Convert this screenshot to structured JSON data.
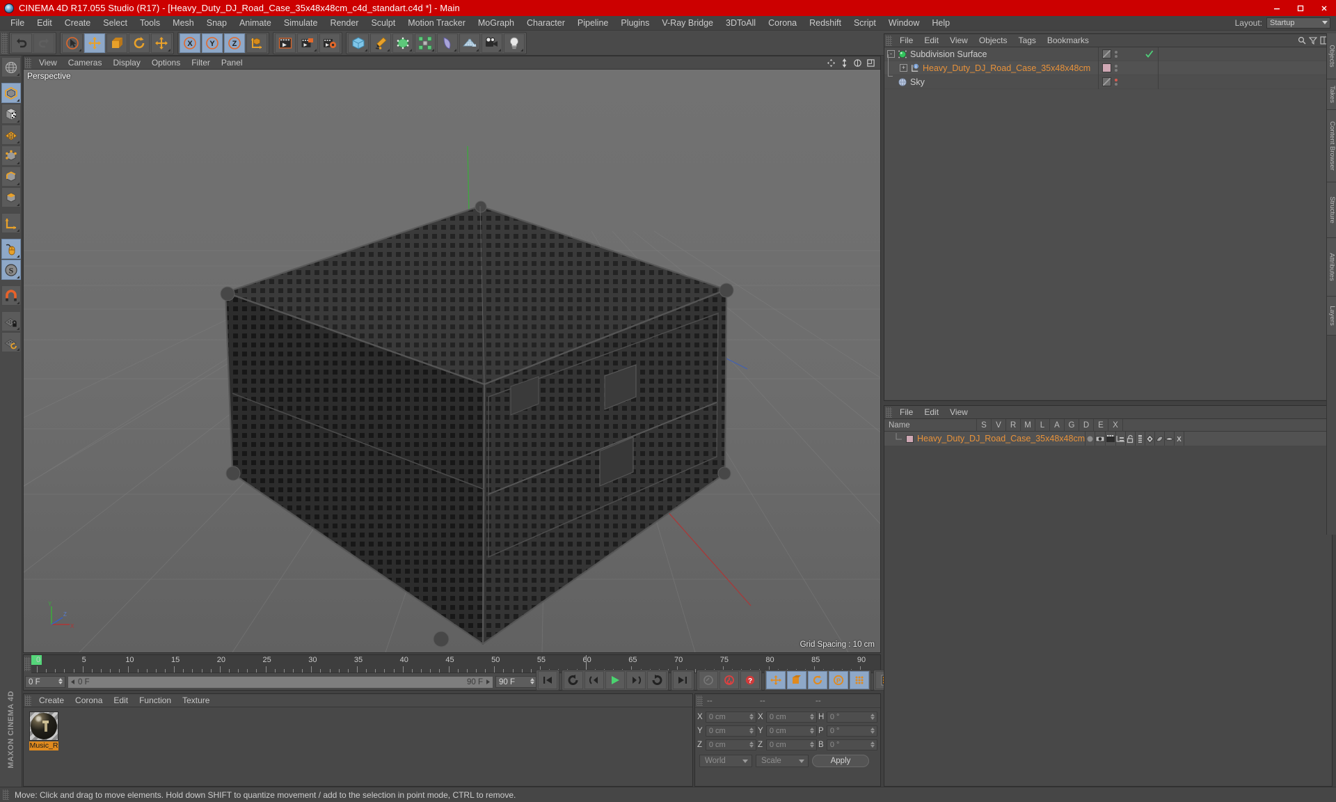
{
  "window": {
    "title": "CINEMA 4D R17.055 Studio (R17) - [Heavy_Duty_DJ_Road_Case_35x48x48cm_c4d_standart.c4d *] - Main",
    "minimize": "–",
    "maximize": "❐",
    "close": "✕"
  },
  "menubar": {
    "items": [
      "File",
      "Edit",
      "Create",
      "Select",
      "Tools",
      "Mesh",
      "Snap",
      "Animate",
      "Simulate",
      "Render",
      "Sculpt",
      "Motion Tracker",
      "MoGraph",
      "Character",
      "Pipeline",
      "Plugins",
      "V-Ray Bridge",
      "3DToAll",
      "Corona",
      "Redshift",
      "Script",
      "Window",
      "Help"
    ],
    "layout_label": "Layout:",
    "layout_value": "Startup"
  },
  "toolbar": {
    "groups": [
      {
        "name": "history",
        "buttons": [
          {
            "name": "undo-button",
            "icon": "undo",
            "state": "normal"
          },
          {
            "name": "redo-button",
            "icon": "redo",
            "state": "dim"
          }
        ]
      },
      {
        "name": "transform",
        "buttons": [
          {
            "name": "select-tool",
            "icon": "live-selection",
            "state": "normal",
            "corner": true
          },
          {
            "name": "move-tool",
            "icon": "move",
            "state": "active"
          },
          {
            "name": "scale-tool",
            "icon": "scale",
            "state": "normal"
          },
          {
            "name": "rotate-tool",
            "icon": "rotate",
            "state": "normal"
          },
          {
            "name": "move-extra-tool",
            "icon": "move",
            "state": "normal",
            "corner": true
          }
        ]
      },
      {
        "name": "axis-locks",
        "buttons": [
          {
            "name": "x-axis-lock",
            "icon": "x",
            "state": "active"
          },
          {
            "name": "y-axis-lock",
            "icon": "y",
            "state": "active"
          },
          {
            "name": "z-axis-lock",
            "icon": "z",
            "state": "active"
          },
          {
            "name": "world-object-axis",
            "icon": "axis-cube",
            "state": "normal"
          }
        ]
      },
      {
        "name": "render",
        "buttons": [
          {
            "name": "render-view-button",
            "icon": "render-view",
            "state": "normal"
          },
          {
            "name": "render-region-button",
            "icon": "render-region",
            "state": "normal",
            "corner": true
          },
          {
            "name": "render-settings-button",
            "icon": "render-settings",
            "state": "normal"
          }
        ]
      },
      {
        "name": "create",
        "buttons": [
          {
            "name": "cube-primitive-button",
            "icon": "cube-blue",
            "state": "normal",
            "corner": true
          },
          {
            "name": "spline-pen-button",
            "icon": "pen",
            "state": "normal",
            "corner": true
          },
          {
            "name": "generator-button",
            "icon": "cube-green",
            "state": "normal",
            "corner": true
          },
          {
            "name": "deformer-button",
            "icon": "array-green",
            "state": "normal",
            "corner": true
          },
          {
            "name": "bend-button",
            "icon": "bend",
            "state": "normal",
            "corner": true
          },
          {
            "name": "floor-button",
            "icon": "floor",
            "state": "normal",
            "corner": true
          },
          {
            "name": "camera-button",
            "icon": "camera",
            "state": "normal",
            "corner": true
          },
          {
            "name": "light-button",
            "icon": "light-bulb",
            "state": "normal",
            "corner": true
          }
        ]
      }
    ]
  },
  "left_toolbar": {
    "items": [
      {
        "name": "undo-view-button",
        "icon": "globe-grid"
      },
      {
        "name": "model-mode-button",
        "icon": "cube-mode",
        "state": "active"
      },
      {
        "name": "texture-mode-button",
        "icon": "cube-checker"
      },
      {
        "name": "polygon-mode-button",
        "icon": "grid-dots"
      },
      {
        "name": "point-mode-button",
        "icon": "cube-points"
      },
      {
        "name": "edge-mode-button",
        "icon": "cube-edges"
      },
      {
        "name": "face-mode-button",
        "icon": "cube-orange"
      },
      {
        "name": "axis-mode-button",
        "icon": "axis-corner"
      },
      {
        "name": "enable-mouse-button",
        "icon": "mouse",
        "state": "active"
      },
      {
        "name": "snap-mode-button",
        "icon": "snap-s",
        "state": "active"
      },
      {
        "name": "magnet-tool-button",
        "icon": "magnet"
      },
      {
        "name": "lock-workplane-button",
        "icon": "grid-lock"
      },
      {
        "name": "workplane-button",
        "icon": "grid-rotate"
      }
    ],
    "brand": "MAXON CINEMA 4D"
  },
  "viewport": {
    "menus": [
      "View",
      "Cameras",
      "Display",
      "Options",
      "Filter",
      "Panel"
    ],
    "label": "Perspective",
    "grid_spacing": "Grid Spacing : 10 cm",
    "nav_icons": [
      "pan-icon",
      "zoom-icon",
      "rotate-icon",
      "maximize-view-icon"
    ]
  },
  "timeline": {
    "tick_labels": [
      "0",
      "5",
      "10",
      "15",
      "20",
      "25",
      "30",
      "35",
      "40",
      "45",
      "50",
      "55",
      "60",
      "65",
      "70",
      "75",
      "80",
      "85",
      "90"
    ],
    "current_frame": "0 F",
    "start_frame": "0 F",
    "end_frame_slider": "90 F",
    "end_frame": "90 F",
    "transport": [
      {
        "name": "go-to-start-button",
        "icon": "skip-start"
      },
      {
        "name": "play-backwards-loop-button",
        "icon": "loop-back"
      },
      {
        "name": "previous-key-button",
        "icon": "prev-key"
      },
      {
        "name": "play-button",
        "icon": "play"
      },
      {
        "name": "next-key-button",
        "icon": "next-key"
      },
      {
        "name": "loop-forward-button",
        "icon": "loop-fwd"
      },
      {
        "name": "go-to-end-button",
        "icon": "skip-end"
      },
      {
        "name": "record-active-objects-button",
        "icon": "key-dim"
      },
      {
        "name": "autokeying-button",
        "icon": "record-red"
      },
      {
        "name": "keyframe-selection-button",
        "icon": "question-red"
      },
      {
        "name": "position-key-button",
        "icon": "move-orange",
        "state": "active"
      },
      {
        "name": "scale-key-button",
        "icon": "scale-orange",
        "state": "active"
      },
      {
        "name": "rotation-key-button",
        "icon": "rotate-orange",
        "state": "active"
      },
      {
        "name": "parameter-key-button",
        "icon": "param-orange",
        "state": "active"
      },
      {
        "name": "point-level-animation-button",
        "icon": "dots-orange",
        "state": "active"
      },
      {
        "name": "timeline-filmstrip-button",
        "icon": "filmstrip-orange"
      }
    ]
  },
  "material_manager": {
    "menus": [
      "Create",
      "Corona",
      "Edit",
      "Function",
      "Texture"
    ],
    "materials": [
      {
        "name": "Music_R",
        "selected": true
      }
    ]
  },
  "coordinates": {
    "headers": [
      "--",
      "--",
      "--"
    ],
    "rows": [
      {
        "label1": "X",
        "value1": "0 cm",
        "label2": "X",
        "value2": "0 cm",
        "label3": "H",
        "value3": "0 °"
      },
      {
        "label1": "Y",
        "value1": "0 cm",
        "label2": "Y",
        "value2": "0 cm",
        "label3": "P",
        "value3": "0 °"
      },
      {
        "label1": "Z",
        "value1": "0 cm",
        "label2": "Z",
        "value2": "0 cm",
        "label3": "B",
        "value3": "0 °"
      }
    ],
    "coord_system": "World",
    "size_mode": "Scale",
    "apply_label": "Apply"
  },
  "object_manager": {
    "menus": [
      "File",
      "Edit",
      "View",
      "Objects",
      "Tags",
      "Bookmarks"
    ],
    "objects": [
      {
        "name": "Subdivision Surface",
        "icon": "subdivision-surface-icon",
        "indent": 0,
        "expand": "-",
        "tag": "diag",
        "state": "check",
        "selected": false
      },
      {
        "name": "Heavy_Duty_DJ_Road_Case_35x48x48cm",
        "icon": "null-zero-icon",
        "indent": 1,
        "expand": "+",
        "tag": "pink",
        "state": "none",
        "selected": true
      },
      {
        "name": "Sky",
        "icon": "sky-icon",
        "indent": 0,
        "expand": "",
        "tag": "diag",
        "state": "dot-red",
        "selected": false
      }
    ]
  },
  "layer_manager": {
    "menus": [
      "File",
      "Edit",
      "View"
    ],
    "columns": [
      "Name",
      "S",
      "V",
      "R",
      "M",
      "L",
      "A",
      "G",
      "D",
      "E",
      "X"
    ],
    "rows": [
      {
        "name": "Heavy_Duty_DJ_Road_Case_35x48x48cm",
        "swatch_color": "#cfa8b4"
      }
    ]
  },
  "edge_tabs": [
    "Objects",
    "Takes",
    "Content Browser",
    "Structure",
    "Attributes",
    "Layers"
  ],
  "statusbar": {
    "message": "Move: Click and drag to move elements. Hold down SHIFT to quantize movement / add to the selection in point mode, CTRL to remove."
  },
  "colors": {
    "title_red": "#cc0000",
    "accent_orange": "#e8923a",
    "panel_bg": "#484848",
    "toolbar_bg": "#4a4a4a",
    "active_blue": "#8ea8c8",
    "viewport_bg": "#6a6a6a"
  }
}
